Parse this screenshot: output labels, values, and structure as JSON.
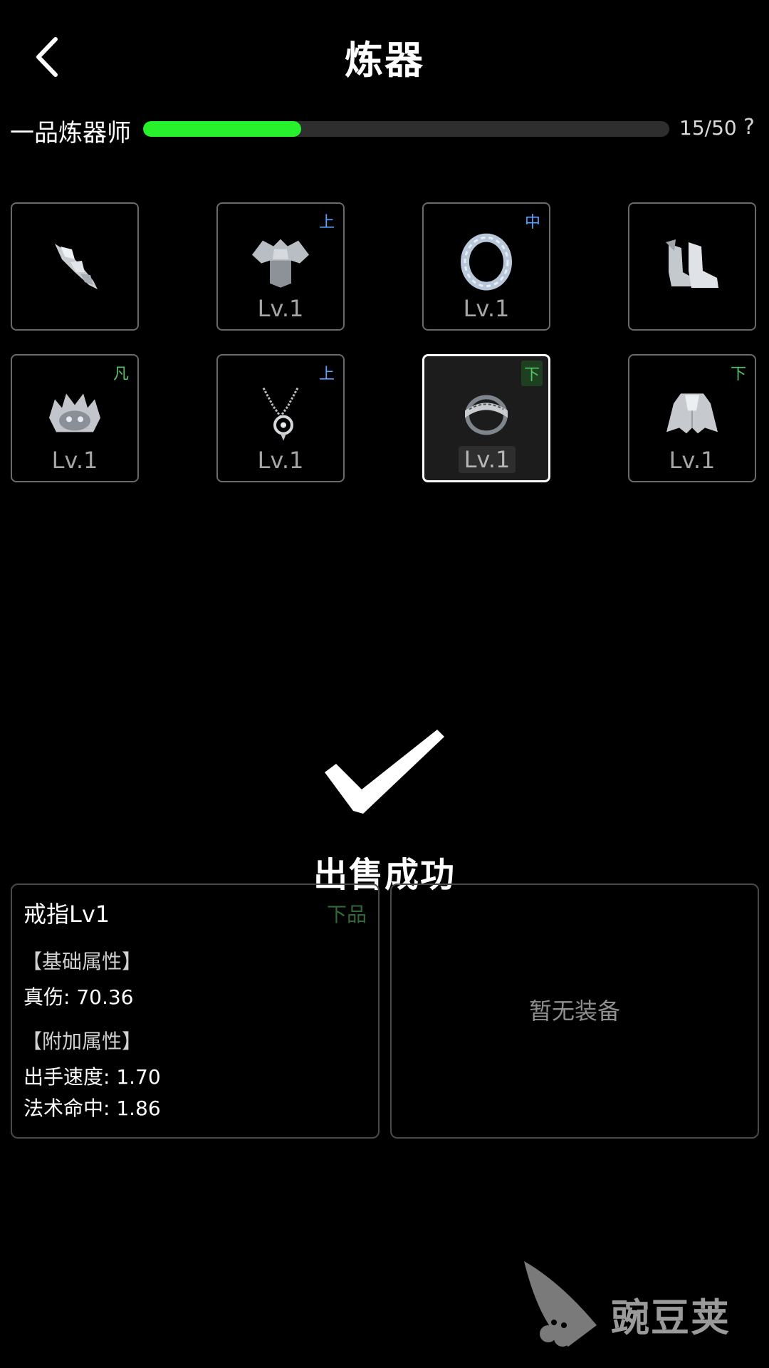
{
  "header": {
    "title": "炼器",
    "back_icon": "chevron-left-icon"
  },
  "rank": {
    "label": "一品炼器师",
    "count_text": "15/50",
    "progress": 0.3,
    "help_symbol": "?"
  },
  "colors": {
    "progress": "#27f12c",
    "grade_blue": "#5aa0ff",
    "grade_green": "#55c463"
  },
  "equipment_slots": [
    {
      "icon": "sword-icon",
      "level": "",
      "grade": ""
    },
    {
      "icon": "armor-icon",
      "level": "Lv.1",
      "grade": "上"
    },
    {
      "icon": "bracelet-icon",
      "level": "Lv.1",
      "grade": "中"
    },
    {
      "icon": "boots-icon",
      "level": "",
      "grade": ""
    },
    {
      "icon": "helmet-icon",
      "level": "Lv.1",
      "grade": "凡"
    },
    {
      "icon": "necklace-icon",
      "level": "Lv.1",
      "grade": "上"
    },
    {
      "icon": "ring-icon",
      "level": "Lv.1",
      "grade": "下"
    },
    {
      "icon": "cloak-icon",
      "level": "Lv.1",
      "grade": "下"
    }
  ],
  "sale": {
    "message": "出售成功",
    "icon": "checkmark-icon"
  },
  "item_detail": {
    "name": "戒指Lv1",
    "quality": "下品",
    "base_title": "【基础属性】",
    "base_stats": [
      "真伤: 70.36"
    ],
    "extra_title": "【附加属性】",
    "extra_stats": [
      "出手速度: 1.70",
      "法术命中: 1.86"
    ]
  },
  "compare_panel": {
    "empty_text": "暂无装备"
  },
  "watermark": {
    "text": "豌豆荚",
    "icon": "pea-logo-icon"
  }
}
